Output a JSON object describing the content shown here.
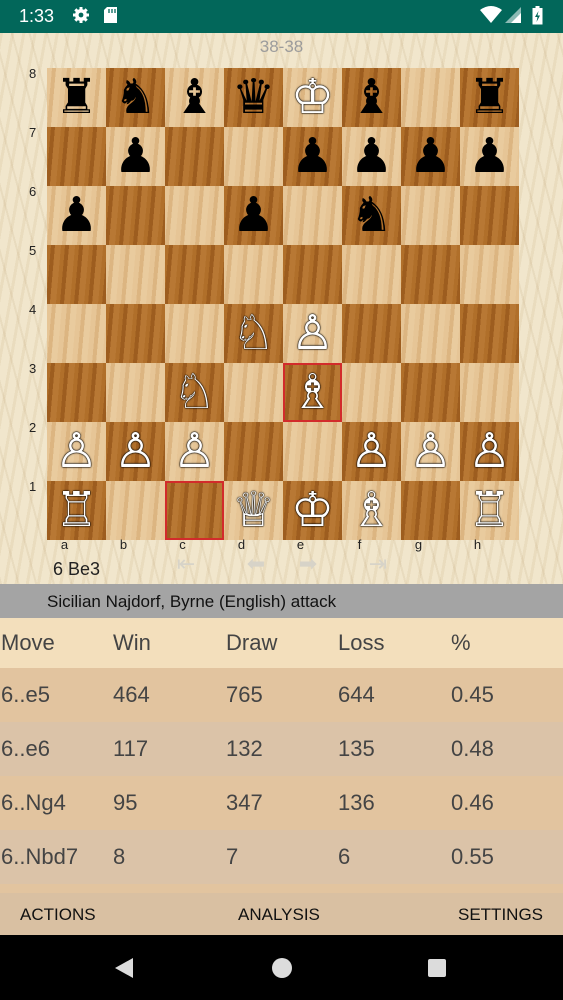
{
  "status_bar": {
    "time": "1:33",
    "icons": [
      "gear-icon",
      "sd-card-icon",
      "wifi-icon",
      "signal-icon",
      "battery-icon"
    ]
  },
  "board": {
    "score": "38-38",
    "ranks": [
      "8",
      "7",
      "6",
      "5",
      "4",
      "3",
      "2",
      "1"
    ],
    "files": [
      "a",
      "b",
      "c",
      "d",
      "e",
      "f",
      "g",
      "h"
    ],
    "pieces": [
      {
        "square": "a8",
        "glyph": "♜",
        "color": "b",
        "name": "black-rook-icon"
      },
      {
        "square": "b8",
        "glyph": "♞",
        "color": "b",
        "name": "black-knight-icon"
      },
      {
        "square": "c8",
        "glyph": "♝",
        "color": "b",
        "name": "black-bishop-icon"
      },
      {
        "square": "d8",
        "glyph": "♛",
        "color": "b",
        "name": "black-queen-icon"
      },
      {
        "square": "e8",
        "glyph": "♔",
        "color": "w",
        "name": "white-king-icon"
      },
      {
        "square": "f8",
        "glyph": "♝",
        "color": "b",
        "name": "black-bishop-icon"
      },
      {
        "square": "h8",
        "glyph": "♜",
        "color": "b",
        "name": "black-rook-icon"
      },
      {
        "square": "b7",
        "glyph": "♟",
        "color": "b",
        "name": "black-pawn-icon"
      },
      {
        "square": "e7",
        "glyph": "♟",
        "color": "b",
        "name": "black-pawn-icon"
      },
      {
        "square": "f7",
        "glyph": "♟",
        "color": "b",
        "name": "black-pawn-icon"
      },
      {
        "square": "g7",
        "glyph": "♟",
        "color": "b",
        "name": "black-pawn-icon"
      },
      {
        "square": "h7",
        "glyph": "♟",
        "color": "b",
        "name": "black-pawn-icon"
      },
      {
        "square": "a6",
        "glyph": "♟",
        "color": "b",
        "name": "black-pawn-icon"
      },
      {
        "square": "d6",
        "glyph": "♟",
        "color": "b",
        "name": "black-pawn-icon"
      },
      {
        "square": "f6",
        "glyph": "♞",
        "color": "b",
        "name": "black-knight-icon"
      },
      {
        "square": "d4",
        "glyph": "♘",
        "color": "w",
        "name": "white-knight-icon"
      },
      {
        "square": "e4",
        "glyph": "♙",
        "color": "w",
        "name": "white-pawn-icon"
      },
      {
        "square": "c3",
        "glyph": "♘",
        "color": "w",
        "name": "white-knight-icon"
      },
      {
        "square": "e3",
        "glyph": "♗",
        "color": "w",
        "name": "white-bishop-icon"
      },
      {
        "square": "a2",
        "glyph": "♙",
        "color": "w",
        "name": "white-pawn-icon"
      },
      {
        "square": "b2",
        "glyph": "♙",
        "color": "w",
        "name": "white-pawn-icon"
      },
      {
        "square": "c2",
        "glyph": "♙",
        "color": "w",
        "name": "white-pawn-icon"
      },
      {
        "square": "f2",
        "glyph": "♙",
        "color": "w",
        "name": "white-pawn-icon"
      },
      {
        "square": "g2",
        "glyph": "♙",
        "color": "w",
        "name": "white-pawn-icon"
      },
      {
        "square": "h2",
        "glyph": "♙",
        "color": "w",
        "name": "white-pawn-icon"
      },
      {
        "square": "a1",
        "glyph": "♖",
        "color": "w",
        "name": "white-rook-icon"
      },
      {
        "square": "d1",
        "glyph": "♕",
        "color": "w",
        "name": "white-queen-icon"
      },
      {
        "square": "e1",
        "glyph": "♔",
        "color": "w",
        "name": "white-king-icon"
      },
      {
        "square": "f1",
        "glyph": "♗",
        "color": "w",
        "name": "white-bishop-icon"
      },
      {
        "square": "h1",
        "glyph": "♖",
        "color": "w",
        "name": "white-rook-icon"
      }
    ],
    "highlights": [
      "c1",
      "e3"
    ],
    "highlight_color": "#d22b2b",
    "last_move": "6 Be3",
    "nav_icons": [
      "first-move-icon",
      "previous-move-icon",
      "next-move-icon",
      "last-move-icon"
    ]
  },
  "opening": {
    "name": "Sicilian Najdorf, Byrne (English) attack"
  },
  "moves_table": {
    "headers": [
      "Move",
      "Win",
      "Draw",
      "Loss",
      "%"
    ],
    "rows": [
      [
        "6..e5",
        "464",
        "765",
        "644",
        "0.45"
      ],
      [
        "6..e6",
        "117",
        "132",
        "135",
        "0.48"
      ],
      [
        "6..Ng4",
        "95",
        "347",
        "136",
        "0.46"
      ],
      [
        "6..Nbd7",
        "8",
        "7",
        "6",
        "0.55"
      ]
    ],
    "row_colors": [
      "#e2c49f",
      "#dbc3a8",
      "#e2c49f",
      "#dbc3a8"
    ]
  },
  "actions": {
    "actions_label": "ACTIONS",
    "analysis_label": "ANALYSIS",
    "settings_label": "SETTINGS"
  },
  "colors": {
    "status_bar": "#02675a",
    "opening_bar": "#a4a4a4",
    "action_bar": "#d9c0a2"
  }
}
